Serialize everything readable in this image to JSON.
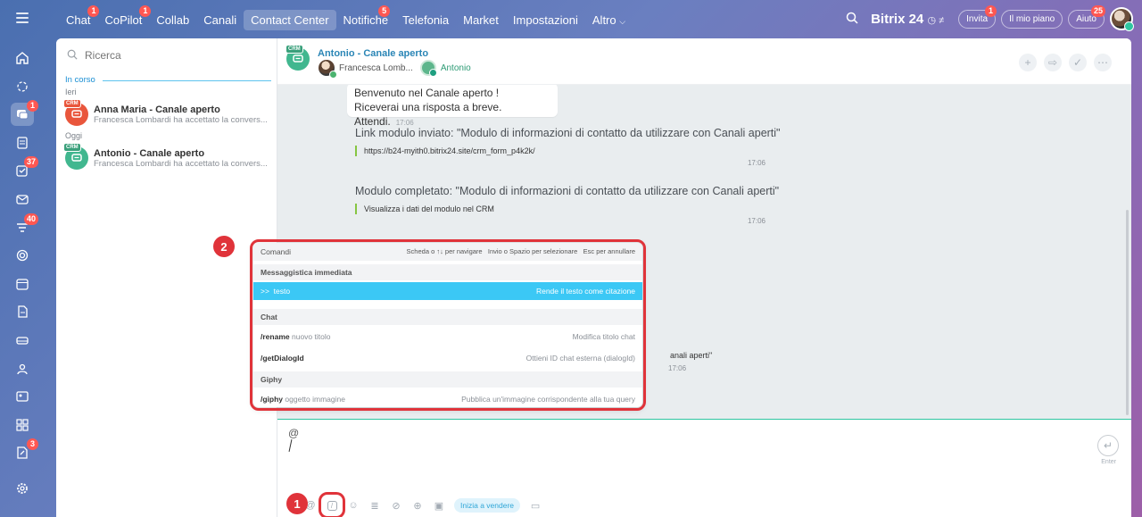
{
  "topbar": {
    "nav": [
      {
        "label": "Chat",
        "badge": "1"
      },
      {
        "label": "CoPilot",
        "badge": "1"
      },
      {
        "label": "Collab",
        "badge": ""
      },
      {
        "label": "Canali",
        "badge": ""
      },
      {
        "label": "Contact Center",
        "badge": "",
        "active": true
      },
      {
        "label": "Notifiche",
        "badge": "5"
      },
      {
        "label": "Telefonia",
        "badge": ""
      },
      {
        "label": "Market",
        "badge": ""
      },
      {
        "label": "Impostazioni",
        "badge": ""
      },
      {
        "label": "Altro",
        "badge": ""
      }
    ],
    "brand": "Bitrix 24",
    "invite": {
      "label": "Invita",
      "badge": "1"
    },
    "plan": "Il mio piano",
    "help": {
      "label": "Aiuto",
      "badge": "25"
    }
  },
  "rail": {
    "badges": {
      "chat": "1",
      "tasks": "37",
      "feed": "40",
      "sign": "3"
    }
  },
  "sidebar": {
    "search_placeholder": "Ricerca",
    "section": "In corso",
    "groups": [
      {
        "day": "Ieri",
        "items": [
          {
            "name": "Anna Maria - Canale aperto",
            "sub": "Francesca Lombardi ha accettato la convers...",
            "tag": "CRM"
          }
        ]
      },
      {
        "day": "Oggi",
        "items": [
          {
            "name": "Antonio - Canale aperto",
            "sub": "Francesca Lombardi ha accettato la convers...",
            "tag": "CRM"
          }
        ]
      }
    ]
  },
  "chat": {
    "tag": "CRM",
    "title": "Antonio - Canale aperto",
    "user1": "Francesca Lomb...",
    "user2": "Antonio",
    "welcome_line1": "Benvenuto nel Canale aperto !",
    "welcome_line2": "Riceverai una risposta a breve. Attendi.",
    "welcome_time": "17:06",
    "msg1_title": "Link modulo inviato: \"Modulo di informazioni di contatto da utilizzare con Canali aperti\"",
    "msg1_link": "https://b24-myith0.bitrix24.site/crm_form_p4k2k/",
    "msg1_time": "17:06",
    "msg2_title": "Modulo completato: \"Modulo di informazioni di contatto da utilizzare con Canali aperti\"",
    "msg2_quote": "Visualizza i dati del modulo nel CRM",
    "msg2_time": "17:06",
    "partial_text": "anali aperti\"",
    "partial_time": "17:06"
  },
  "commands": {
    "title": "Comandi",
    "hint_nav": "Scheda o ↑↓ per navigare",
    "hint_select": "Invio o Spazio per selezionare",
    "hint_cancel": "Esc per annullare",
    "groups": [
      {
        "name": "Messaggistica immediata",
        "items": [
          {
            "cmd": ">>",
            "arg": "testo",
            "desc": "Rende il testo come citazione"
          }
        ]
      },
      {
        "name": "Chat",
        "items": [
          {
            "cmd": "/rename",
            "arg": "nuovo titolo",
            "desc": "Modifica titolo chat"
          },
          {
            "cmd": "/getDialogId",
            "arg": "",
            "desc": "Ottieni ID chat esterna (dialogId)"
          }
        ]
      },
      {
        "name": "Giphy",
        "items": [
          {
            "cmd": "/giphy",
            "arg": "oggetto immagine",
            "desc": "Pubblica un'immagine corrispondente alla tua query"
          }
        ]
      }
    ]
  },
  "composer": {
    "text": "@",
    "enter_label": "Enter",
    "sell_label": "Inizia a vendere"
  },
  "markers": {
    "m1": "1",
    "m2": "2"
  },
  "colors": {
    "accent": "#3bc8f5",
    "highlight": "#e0333a",
    "badge": "#ff5752",
    "crm_green": "#41b78f",
    "crm_red": "#e9563c"
  }
}
